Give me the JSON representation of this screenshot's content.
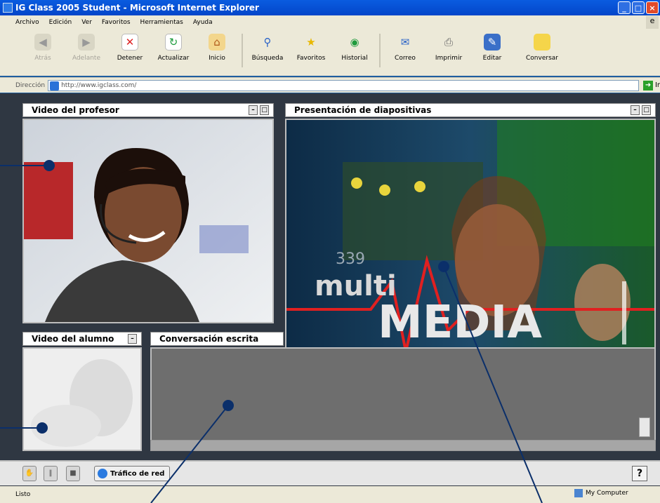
{
  "window": {
    "title": "IG Class 2005 Student - Microsoft Internet Explorer"
  },
  "menu": [
    "Archivo",
    "Edición",
    "Ver",
    "Favoritos",
    "Herramientas",
    "Ayuda"
  ],
  "toolbar": {
    "buttons": [
      {
        "label": "Atrás",
        "icon": "back-icon",
        "disabled": true
      },
      {
        "label": "Adelante",
        "icon": "forward-icon",
        "disabled": true
      },
      {
        "label": "Detener",
        "icon": "stop-icon",
        "disabled": false
      },
      {
        "label": "Actualizar",
        "icon": "refresh-icon",
        "disabled": false
      },
      {
        "label": "Inicio",
        "icon": "home-icon",
        "disabled": false
      },
      {
        "label": "Búsqueda",
        "icon": "search-icon",
        "disabled": false
      },
      {
        "label": "Favoritos",
        "icon": "favorites-icon",
        "disabled": false
      },
      {
        "label": "Historial",
        "icon": "history-icon",
        "disabled": false
      },
      {
        "label": "Correo",
        "icon": "mail-icon",
        "disabled": false
      },
      {
        "label": "Imprimir",
        "icon": "print-icon",
        "disabled": false
      },
      {
        "label": "Editar",
        "icon": "edit-icon",
        "disabled": false
      },
      {
        "label": "Conversar",
        "icon": "discuss-icon",
        "disabled": false
      }
    ]
  },
  "address": {
    "label": "Dirección",
    "url": "http://www.igclass.com/",
    "go": "Ir"
  },
  "panels": {
    "teacher": {
      "title": "Video del profesor"
    },
    "slides": {
      "title": "Presentación de diapositivas",
      "slide_text_top": "multi",
      "slide_text_main": "MEDIA",
      "slide_number": "339"
    },
    "student": {
      "title": "Video del alumno"
    },
    "chat": {
      "title": "Conversación escrita"
    }
  },
  "controls": {
    "traffic_label": "Tráfico de red",
    "help": "?"
  },
  "status": {
    "text": "Listo",
    "zone": "My Computer"
  }
}
